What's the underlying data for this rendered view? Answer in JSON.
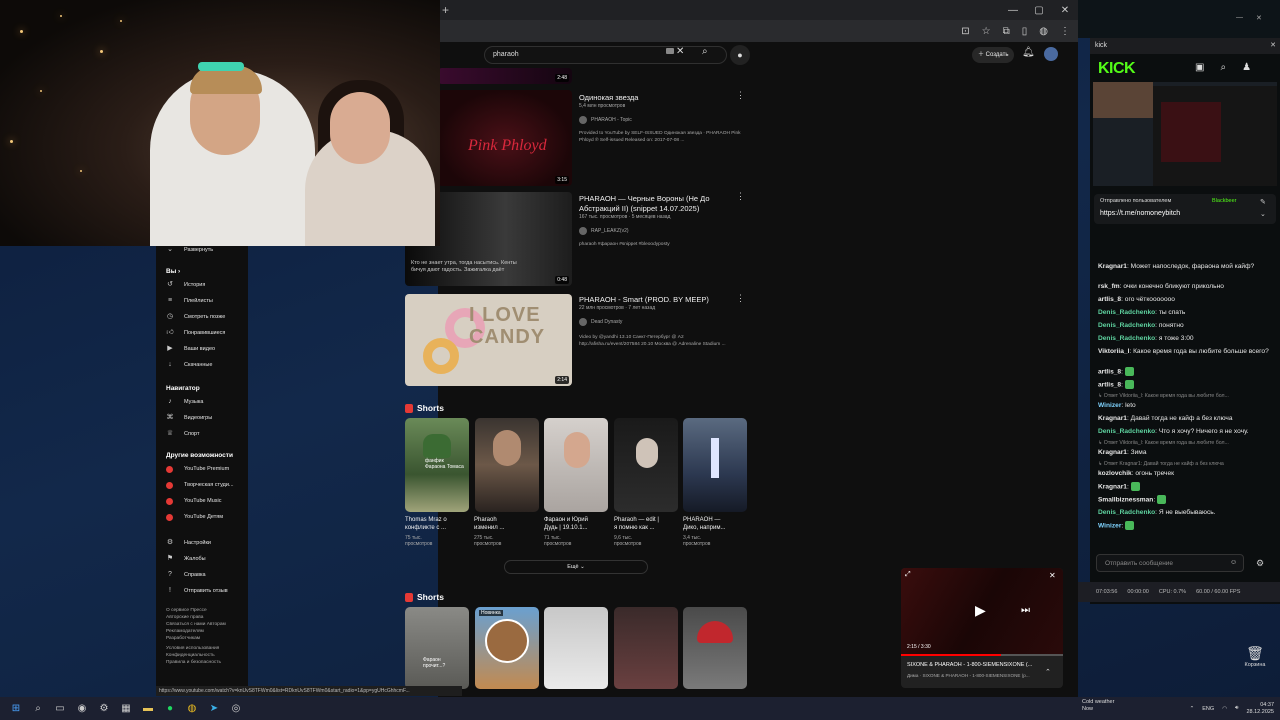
{
  "browser": {
    "window_controls": [
      "—",
      "▢",
      "✕"
    ]
  },
  "youtube": {
    "search_query": "pharaoh",
    "create_label": "Создать",
    "sidebar": {
      "expand_label": "Развернуть",
      "you_header": "Вы",
      "you_items": [
        "История",
        "Плейлисты",
        "Смотреть позже",
        "Понравившиеся",
        "Ваши видео",
        "Скачанные"
      ],
      "nav_header": "Навигатор",
      "nav_items": [
        "Музыка",
        "Видеоигры",
        "Спорт"
      ],
      "other_header": "Другие возможности",
      "other_items": [
        "YouTube Premium",
        "Творческая студи...",
        "YouTube Music",
        "YouTube Детям"
      ],
      "settings_items": [
        "Настройки",
        "Жалобы",
        "Справка",
        "Отправить отзыв"
      ],
      "footer_lines": [
        "О сервисе  Прессе",
        "Авторские права",
        "Связаться с нами  Авторам",
        "Рекламодателям",
        "Разработчикам",
        "Условия использования",
        "Конфиденциальность",
        "Правила и безопасность"
      ]
    },
    "results": [
      {
        "duration": "2:48"
      },
      {
        "title": "Одинокая звезда",
        "meta": "5,4 млн просмотров",
        "channel": "PHARAOH - Topic",
        "desc1": "Provided to YouTube by SELF-ISSUED Одинокая звезда · PHARAOH Pink",
        "desc2": "Phloyd ℗ Self-issued Released on: 2017-07-08 ...",
        "duration": "3:15"
      },
      {
        "title1": "PHARAOH — Черные Вороны (Не До",
        "title2": "Абстракций II) (snippet 14.07.2025)",
        "meta": "167 тыс. просмотров · 5 месяцев назад",
        "channel": "RAP_LEAKZ(v2)",
        "desc1": "pharaoh #фараон #snippet #bleoodyposty",
        "thumb_text1": "Кто не знает утра, тогда насытись. Кенты",
        "thumb_text2": "бичуя дают гадость. Зажигалка даёт",
        "duration": "0:48"
      },
      {
        "title": "PHARAOH - Smart (PROD. BY MEEP)",
        "meta": "22 млн просмотров · 7 лет назад",
        "channel": "Dead Dynasty",
        "desc1": "Video by @yandhi 13.10 Санкт-Петербург @ A2",
        "desc2": "http://afisha.ru/event/207584 20.10 Москва @ Adrenaline Stadium ...",
        "thumb_text1": "I LOVE",
        "thumb_text2": "CANDY",
        "duration": "2:14"
      }
    ],
    "shorts_label": "Shorts",
    "shorts": [
      {
        "title1": "Thomas Mraz о",
        "title2": "конфликте с ...",
        "views1": "75 тыс.",
        "views2": "просмотров",
        "overlay": "фанфик Фараона Томаса"
      },
      {
        "title1": "Pharaoh",
        "title2": "изменил ...",
        "views1": "275 тыс.",
        "views2": "просмотров"
      },
      {
        "title1": "Фараон и Юрий",
        "title2": "Дудь | 19.10.1...",
        "views1": "71 тыс.",
        "views2": "просмотров"
      },
      {
        "title1": "Pharaoh — edit |",
        "title2": "я помню как ...",
        "views1": "9,6 тыс.",
        "views2": "просмотров"
      },
      {
        "title1": "PHARAOH —",
        "title2": "Дико, наприм...",
        "views1": "3,4 тыс.",
        "views2": "просмотров"
      }
    ],
    "more_label": "Ещё",
    "shorts2_label": "Shorts",
    "shorts2_overlays": [
      "Фараон прочит...?",
      "Новинка"
    ],
    "status_url": "https://www.youtube.com/watch?v=knUvS8TFWm0&list=RDknUvS8TFWm0&start_radio=1&pp=ygUHcGhhcmF..."
  },
  "miniplayer": {
    "time": "2:15 / 3:30",
    "title": "SIXONE & PHARAOH - 1-800-SIEMENSIXONE (...",
    "sub": "Дима · SIXONE & PHARAOH - 1-800-SIEMENSIXONE (p..."
  },
  "kick": {
    "window_title": "kick",
    "logo": "KICK",
    "pinned_sent": "Отправлено пользователем",
    "pinned_user": "Blackbeer",
    "pinned_link": "https://t.me/nomoneybitch",
    "messages": [
      {
        "user": "Kragnar1",
        "text": "Может напоследок, фараона мой кайф?",
        "color": "#e8e8e8"
      },
      {
        "user": "rsk_fm",
        "text": "очки конечно бликуют прикольно",
        "color": "#e8e8e8"
      },
      {
        "user": "artlis_8",
        "text": "ого чёткооооооо",
        "color": "#e8e8e8"
      },
      {
        "user": "Denis_Radchenko",
        "text": "ты спать",
        "color": "#5fd3a0"
      },
      {
        "user": "Denis_Radchenko",
        "text": "понятно",
        "color": "#5fd3a0"
      },
      {
        "user": "Denis_Radchenko",
        "text": "я тоже 3:00",
        "color": "#5fd3a0"
      },
      {
        "user": "Viktoriia_l",
        "text": "Какое время года вы любите больше всего?",
        "color": "#e8e8e8"
      },
      {
        "user": "artlis_8",
        "text": "",
        "color": "#e8e8e8"
      },
      {
        "user": "artlis_8",
        "text": "",
        "color": "#e8e8e8"
      },
      {
        "reply": "↳ Ответ Viktoriia_l: Какое время года вы любите бол..."
      },
      {
        "user": "Winizer",
        "text": "leto",
        "color": "#7fd3ff"
      },
      {
        "user": "Kragnar1",
        "text": "Давай тогда не кайф а без ключа",
        "color": "#e8e8e8"
      },
      {
        "user": "Denis_Radchenko",
        "text": "Что я хочу? Ничего я не хочу.",
        "color": "#5fd3a0"
      },
      {
        "reply": "↳ Ответ Viktoriia_l: Какое время года вы любите бол..."
      },
      {
        "user": "Kragnar1",
        "text": "Зима",
        "color": "#e8e8e8"
      },
      {
        "reply": "↳ Ответ Kragnar1: Давай тогда не кайф а без ключа"
      },
      {
        "user": "kozlovchik",
        "text": "огонь тречек",
        "color": "#e8e8e8"
      },
      {
        "user": "Kragnar1",
        "text": "",
        "color": "#e8e8e8"
      },
      {
        "user": "Smallbiznessman",
        "text": "",
        "color": "#e8e8e8"
      },
      {
        "user": "Denis_Radchenko",
        "text": "Я не выебываюсь.",
        "color": "#5fd3a0"
      },
      {
        "user": "Winizer",
        "text": "",
        "color": "#7fd3ff"
      }
    ],
    "input_placeholder": "Отправить сообщение"
  },
  "obs": {
    "time": "07:03:56",
    "rec": "00:00:00",
    "cpu": "CPU: 0.7%",
    "fps": "60.00 / 60.00 FPS"
  },
  "taskbar": {
    "weather_title": "Cold weather",
    "weather_sub": "Now",
    "lang": "ENG",
    "clock_time": "04:37",
    "clock_date": "28.12.2025",
    "trash": "Корзина"
  }
}
